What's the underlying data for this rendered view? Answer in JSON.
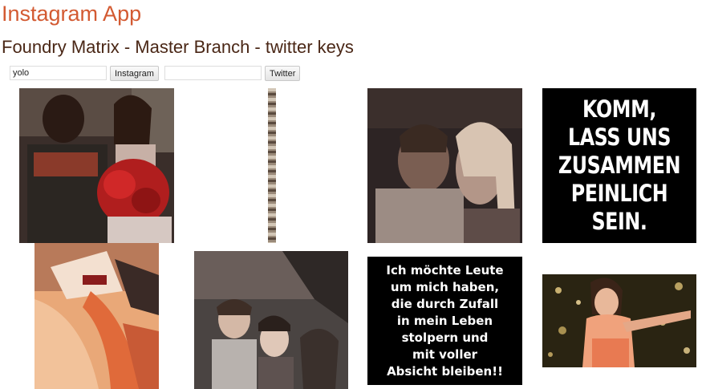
{
  "header": {
    "title": "Instagram App",
    "subtitle": "Foundry Matrix - Master Branch - twitter keys"
  },
  "search": {
    "instagram_value": "yolo",
    "instagram_button": "Instagram",
    "twitter_value": "",
    "twitter_button": "Twitter"
  },
  "gallery": {
    "quote_1": "KOMM,\nLASS UNS\nZUSAMMEN\nPEINLICH SEIN.",
    "quote_2": "Ich möchte Leute\num mich haben,\ndie durch Zufall\nin mein Leben\nstolpern und\nmit voller\nAbsicht bleiben!!"
  }
}
